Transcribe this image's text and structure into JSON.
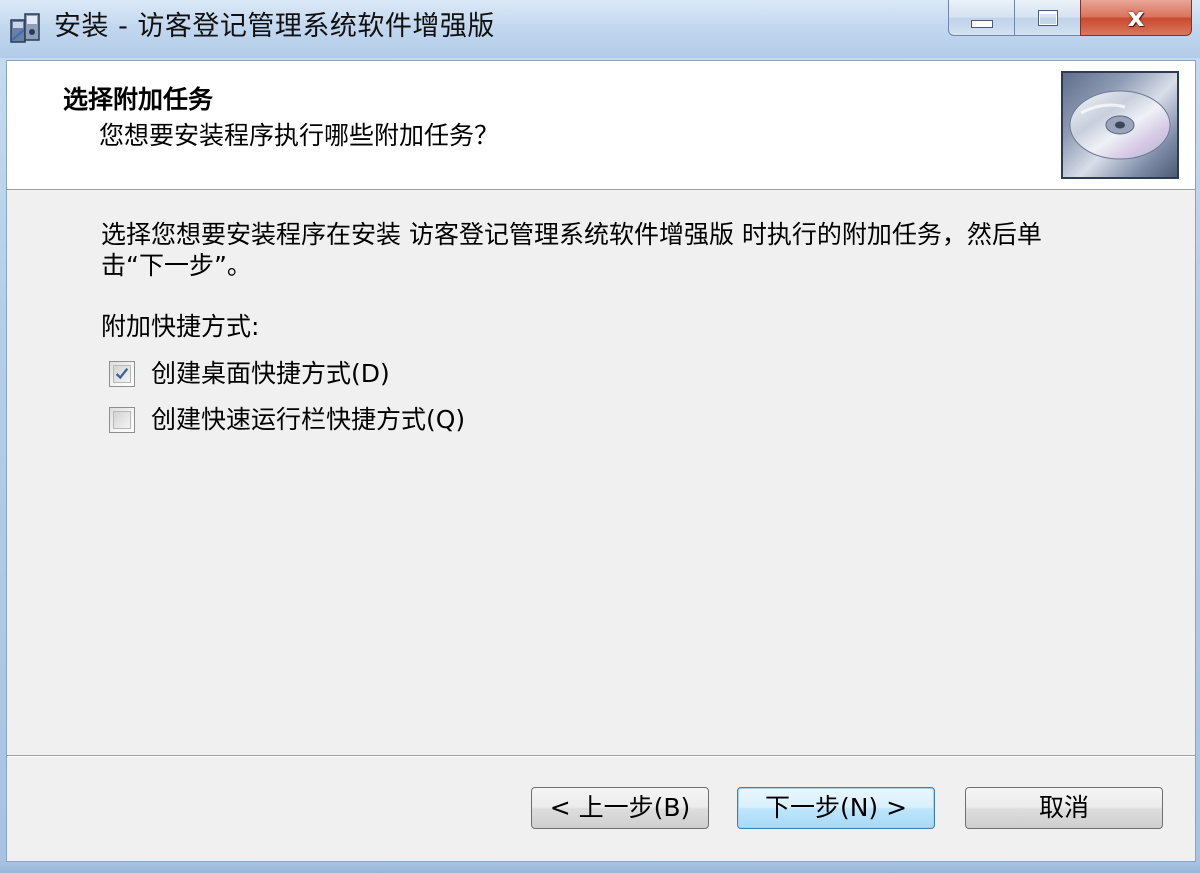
{
  "window": {
    "title": "安装 - 访客登记管理系统软件增强版",
    "icon": "installer-icon",
    "caption_buttons": {
      "minimize_icon": "minimize-icon",
      "maximize_icon": "maximize-icon",
      "close_label": "x"
    }
  },
  "header": {
    "title": "选择附加任务",
    "subtitle": "您想要安装程序执行哪些附加任务？",
    "image_icon": "cd-disc-icon"
  },
  "body": {
    "description": "选择您想要安装程序在安装 访客登记管理系统软件增强版 时执行的附加任务，然后单击“下一步”。",
    "group_label": "附加快捷方式:",
    "tasks": [
      {
        "label": "创建桌面快捷方式(D)",
        "checked": true
      },
      {
        "label": "创建快速运行栏快捷方式(Q)",
        "checked": false
      }
    ]
  },
  "buttons": {
    "back": "< 上一步(B)",
    "next": "下一步(N) >",
    "cancel": "取消"
  },
  "colors": {
    "client_bg": "#f0f0f0",
    "header_bg": "#ffffff",
    "check_mark": "#3b5fa8",
    "close_button": "#c94a2e"
  }
}
